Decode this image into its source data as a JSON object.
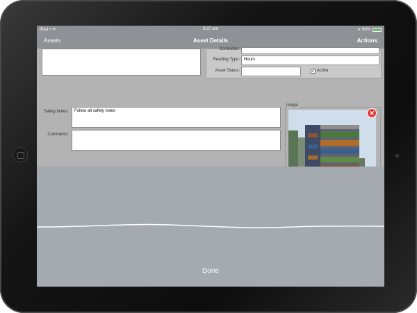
{
  "status_bar": {
    "carrier": "iPad",
    "time": "8:37 am",
    "battery": "96%",
    "battery_level": 0.96
  },
  "nav": {
    "back_label": "Assets",
    "title": "Asset Details",
    "actions_label": "Actions"
  },
  "form": {
    "contractor_label": "Contractor:",
    "contractor_value": "",
    "reading_type_label": "Reading Type:",
    "reading_type_value": "Hours",
    "asset_status_label": "Asset Status:",
    "asset_status_value": "",
    "active_label": "Active",
    "active_checked": true,
    "safety_notes_label": "Safety Notes:",
    "safety_notes_value": "Follow all safety notes",
    "comments_label": "Comments:",
    "comments_value": ""
  },
  "image_section": {
    "label": "Image"
  },
  "keyboard": {
    "done_label": "Done"
  },
  "colors": {
    "nav_bar": "#8f9196",
    "form_background": "#b3b3b3",
    "keyboard_background": "#a4aab0",
    "delete_button": "#e53935"
  }
}
